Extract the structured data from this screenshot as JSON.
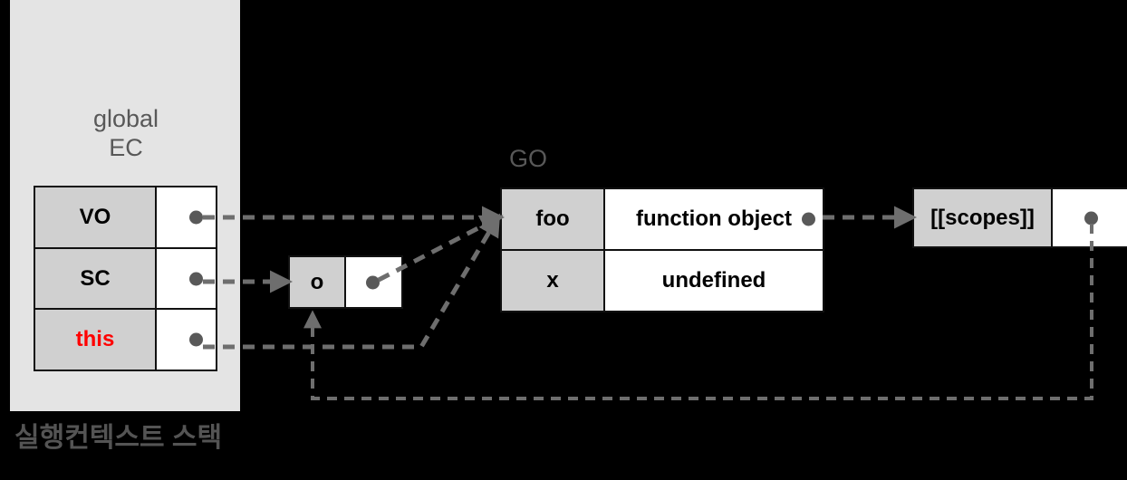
{
  "diagram": {
    "title": "실행컨텍스트 스택",
    "background_color": "#000000",
    "panel_color": "#e4e4e4",
    "accent_color": "#ff0000",
    "wire_color": "#6e6e6e"
  },
  "stack_panel": {
    "label": "global\nEC",
    "table": {
      "rows": [
        {
          "key": "VO",
          "value": "",
          "key_highlight": false,
          "has_pointer_dot": true
        },
        {
          "key": "SC",
          "value": "",
          "key_highlight": false,
          "has_pointer_dot": true
        },
        {
          "key": "this",
          "value": "",
          "key_highlight": true,
          "has_pointer_dot": true
        }
      ]
    }
  },
  "object_box": {
    "label": "o",
    "has_pointer_dot": true
  },
  "global_object": {
    "label": "GO",
    "table": {
      "rows": [
        {
          "key": "foo",
          "value": "function object",
          "has_pointer_dot": true
        },
        {
          "key": "x",
          "value": "undefined",
          "has_pointer_dot": false
        }
      ]
    }
  },
  "scopes_box": {
    "label": "[[scopes]]",
    "has_pointer_dot": true
  },
  "connections": [
    {
      "name": "vo-to-go",
      "from": "VO pointer",
      "to": "GO foo row"
    },
    {
      "name": "sc-to-o",
      "from": "SC pointer",
      "to": "o object box"
    },
    {
      "name": "o-to-go",
      "from": "o pointer",
      "to": "GO foo row"
    },
    {
      "name": "this-to-go",
      "from": "this pointer",
      "to": "GO foo row"
    },
    {
      "name": "foo-to-scopes",
      "from": "function object pointer",
      "to": "[[scopes]] box"
    },
    {
      "name": "scopes-to-o",
      "from": "[[scopes]] pointer",
      "to": "o object box"
    }
  ]
}
